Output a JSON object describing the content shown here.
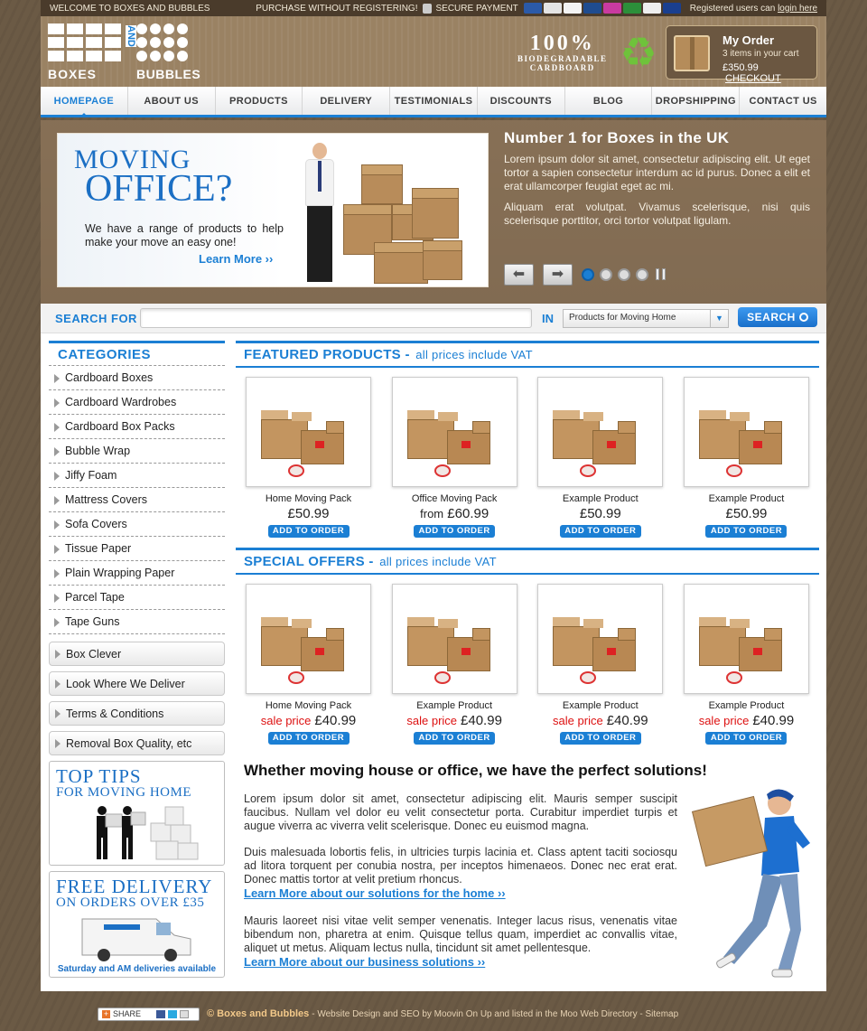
{
  "topbar": {
    "welcome": "WELCOME TO BOXES AND BUBBLES",
    "purchase": "PURCHASE WITHOUT REGISTERING!",
    "secure": "SECURE PAYMENT",
    "registered_prefix": "Registered users can",
    "login": "login here"
  },
  "logo": {
    "boxes": "BOXES",
    "and": "AND",
    "bubbles": "BUBBLES"
  },
  "badge": {
    "percent": "100%",
    "line1": "BIODEGRADABLE",
    "line2": "CARDBOARD"
  },
  "order": {
    "title": "My Order",
    "items": "3 items in your cart",
    "total": "£350.99",
    "checkout": "CHECKOUT"
  },
  "nav": [
    "HOMEPAGE",
    "ABOUT US",
    "PRODUCTS",
    "DELIVERY",
    "TESTIMONIALS",
    "DISCOUNTS",
    "BLOG",
    "DROPSHIPPING",
    "CONTACT US"
  ],
  "hero": {
    "banner_line1": "MOVING",
    "banner_line2": "OFFICE?",
    "banner_copy": "We have a range of products to help make your move an easy one!",
    "banner_link": "Learn More ››",
    "title": "Number 1 for Boxes in the UK",
    "p1": "Lorem ipsum dolor sit amet, consectetur adipiscing elit. Ut eget tortor a sapien consectetur interdum ac id purus. Donec a elit et erat ullamcorper feugiat eget ac mi.",
    "p2": "Aliquam erat volutpat. Vivamus scelerisque, nisi quis scelerisque porttitor, orci tortor volutpat ligulam."
  },
  "search": {
    "label": "SEARCH FOR",
    "in_label": "IN",
    "category": "Products for Moving Home",
    "button": "SEARCH"
  },
  "sidebar": {
    "heading": "CATEGORIES",
    "categories": [
      "Cardboard Boxes",
      "Cardboard Wardrobes",
      "Cardboard Box Packs",
      "Bubble Wrap",
      "Jiffy Foam",
      "Mattress Covers",
      "Sofa Covers",
      "Tissue Paper",
      "Plain Wrapping Paper",
      "Parcel Tape",
      "Tape Guns"
    ],
    "links": [
      "Box Clever",
      "Look Where We Deliver",
      "Terms & Conditions",
      "Removal Box Quality, etc"
    ],
    "tips_line1": "TOP TIPS",
    "tips_line2": "FOR MOVING HOME",
    "delivery_line1": "FREE DELIVERY",
    "delivery_line2": "ON ORDERS OVER £35",
    "delivery_line3": "Saturday and AM deliveries available"
  },
  "featured": {
    "title": "FEATURED PRODUCTS -",
    "subtitle": "all prices include VAT",
    "products": [
      {
        "name": "Home Moving Pack",
        "prefix": "",
        "price": "£50.99"
      },
      {
        "name": "Office Moving Pack",
        "prefix": "from",
        "price": "£60.99"
      },
      {
        "name": "Example Product",
        "prefix": "",
        "price": "£50.99"
      },
      {
        "name": "Example Product",
        "prefix": "",
        "price": "£50.99"
      }
    ],
    "add_label": "ADD TO ORDER"
  },
  "specials": {
    "title": "SPECIAL OFFERS -",
    "subtitle": "all prices include VAT",
    "sale_label": "sale price",
    "products": [
      {
        "name": "Home Moving Pack",
        "price": "£40.99"
      },
      {
        "name": "Example Product",
        "price": "£40.99"
      },
      {
        "name": "Example Product",
        "price": "£40.99"
      },
      {
        "name": "Example Product",
        "price": "£40.99"
      }
    ],
    "add_label": "ADD TO ORDER"
  },
  "solutions": {
    "heading": "Whether moving house or office, we have the perfect solutions!",
    "p1": "Lorem ipsum dolor sit amet, consectetur adipiscing elit. Mauris semper suscipit faucibus. Nullam vel dolor eu velit consectetur porta. Curabitur imperdiet turpis et augue viverra ac viverra velit scelerisque. Donec eu euismod magna.",
    "p2": "Duis malesuada lobortis felis, in ultricies turpis lacinia et. Class aptent taciti sociosqu ad litora torquent per conubia nostra, per inceptos himenaeos. Donec nec erat erat. Donec mattis tortor at velit pretium rhoncus.",
    "link1": "Learn More about our solutions for the home ››",
    "p3": "Mauris laoreet nisi vitae velit semper venenatis. Integer lacus risus, venenatis vitae bibendum non, pharetra at enim. Quisque tellus quam, imperdiet ac convallis vitae, aliquet ut metus. Aliquam lectus nulla, tincidunt sit amet pellentesque.",
    "link2": "Learn More about our business solutions ››"
  },
  "footer": {
    "share": "SHARE",
    "copyright": "© Boxes and Bubbles",
    "credits": "- Website Design and SEO by Moovin On Up and listed in the Moo Web Directory - Sitemap"
  },
  "colors": {
    "accent": "#1b7fd4",
    "brown": "#8c7459",
    "sale": "#dd1111"
  }
}
